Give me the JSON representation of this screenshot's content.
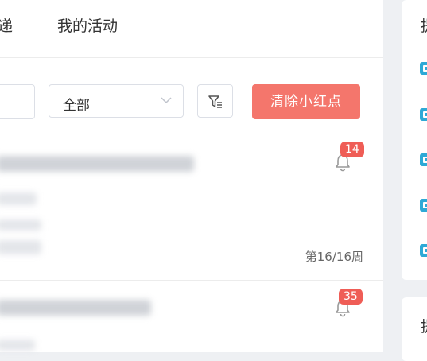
{
  "tabs": {
    "partial_label": "递",
    "activity_label": "我的活动"
  },
  "filters": {
    "select_value": "全部",
    "filter_icon": "filter-icon",
    "clear_label": "清除小红点"
  },
  "cards": [
    {
      "badge_count": "14",
      "week_text": "第16/16周",
      "bell_icon": "bell-icon"
    },
    {
      "badge_count": "35",
      "bell_icon": "bell-icon"
    }
  ],
  "right_panel": {
    "heading_partial": "提",
    "heading2_partial": "提",
    "item_icon": "list-item-icon"
  },
  "colors": {
    "accent": "#f4766c",
    "badge": "#ef5d56",
    "item_icon": "#2ea9d6"
  }
}
